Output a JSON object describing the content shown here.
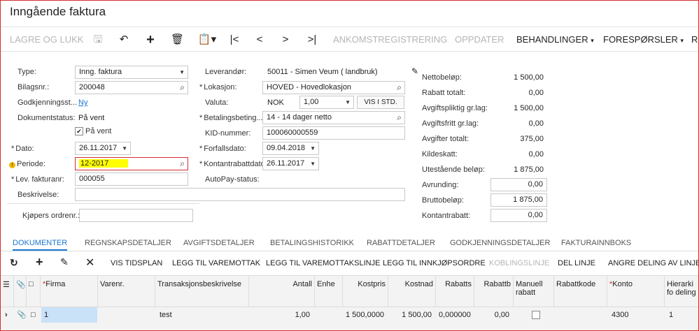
{
  "title": "Inngående faktura",
  "toolbar": {
    "save_close": "LAGRE OG LUKK",
    "receipt": "ANKOMSTREGISTRERING",
    "update": "OPPDATER",
    "actions": "BEHANDLINGER",
    "inquiries": "FORESPØRSLER",
    "reports": "R"
  },
  "form": {
    "type_label": "Type:",
    "type_value": "Inng. faktura",
    "docnr_label": "Bilagsnr.:",
    "docnr_value": "200048",
    "approval_label": "Godkjenningsst...",
    "approval_value": "Ny",
    "status_label": "Dokumentstatus:",
    "status_value": "På vent",
    "hold_label": "På vent",
    "date_label": "Dato:",
    "date_value": "26.11.2017",
    "period_label": "Periode:",
    "period_value": "12-2017",
    "vendref_label": "Lev. fakturanr:",
    "vendref_value": "000055",
    "desc_label": "Beskrivelse:",
    "buyer_label": "Kjøpers ordrenr.:",
    "vendor_label": "Leverandør:",
    "vendor_value": "50011 - Simen Veum ( landbruk)",
    "location_label": "Lokasjon:",
    "location_value": "HOVED - Hovedlokasjon",
    "currency_label": "Valuta:",
    "currency_value": "NOK",
    "rate_value": "1,00",
    "view_base": "VIS I STD.",
    "terms_label": "Betalingsbeting...",
    "terms_value": "14 - 14 dager netto",
    "kid_label": "KID-nummer:",
    "kid_value": "100060000559",
    "due_label": "Forfallsdato:",
    "due_value": "09.04.2018",
    "cashdisc_label": "Kontantrabattdato:",
    "cashdisc_value": "26.11.2017",
    "autopay_label": "AutoPay-status:"
  },
  "totals": [
    {
      "label": "Nettobeløp:",
      "value": "1 500,00"
    },
    {
      "label": "Rabatt totalt:",
      "value": "0,00"
    },
    {
      "label": "Avgiftspliktig gr.lag:",
      "value": "1 500,00"
    },
    {
      "label": "Avgiftsfritt gr.lag:",
      "value": "0,00"
    },
    {
      "label": "Avgifter totalt:",
      "value": "375,00"
    },
    {
      "label": "Kildeskatt:",
      "value": "0,00"
    },
    {
      "label": "Utestående beløp:",
      "value": "1 875,00"
    },
    {
      "label": "Avrunding:",
      "value": "0,00"
    },
    {
      "label": "Bruttobeløp:",
      "value": "1 875,00"
    },
    {
      "label": "Kontantrabatt:",
      "value": "0,00"
    }
  ],
  "tabs": [
    "DOKUMENTER",
    "REGNSKAPSDETALJER",
    "AVGIFTSDETALJER",
    "BETALINGSHISTORIKK",
    "RABATTDETALJER",
    "GODKJENNINGSDETALJER",
    "FAKTURAINNBOKS"
  ],
  "gridbar": {
    "schedule": "VIS TIDSPLAN",
    "add_receipt": "LEGG TIL VAREMOTTAK",
    "add_receipt_line": "LEGG TIL VAREMOTTAKSLINJE",
    "add_po": "LEGG TIL INNKJØPSORDRE",
    "link_line": "KOBLINGSLINJE",
    "split_line": "DEL LINJE",
    "undo_split": "ANGRE DELING AV LINJE"
  },
  "grid": {
    "headers": {
      "firma": "Firma",
      "varenr": "Varenr.",
      "desc": "Transaksjonsbeskrivelse",
      "qty": "Antall",
      "unit": "Enhe",
      "unitcost": "Kostpris",
      "extcost": "Kostnad",
      "disc_pct": "Rabatts",
      "disc_amt": "Rabattb",
      "manual": "Manuell rabatt",
      "disc_code": "Rabattkode",
      "account": "Konto",
      "hier": "Hierarki fo deling"
    },
    "row": {
      "firma": "1",
      "desc": "test",
      "qty": "1,00",
      "unitcost": "1 500,0000",
      "extcost": "1 500,00",
      "disc_pct": "0,000000",
      "disc_amt": "0,00",
      "account": "4300",
      "hier": "1"
    }
  }
}
